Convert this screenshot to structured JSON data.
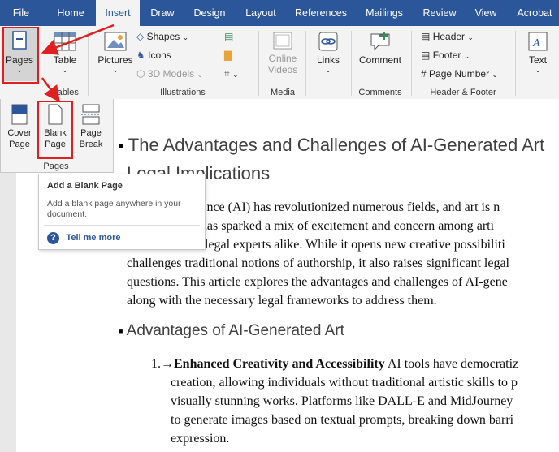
{
  "tabs": [
    "File",
    "Home",
    "Insert",
    "Draw",
    "Design",
    "Layout",
    "References",
    "Mailings",
    "Review",
    "View",
    "Acrobat"
  ],
  "ribbon": {
    "pages": "Pages",
    "table": "Table",
    "tables_group": "Tables",
    "pictures": "Pictures",
    "shapes": "Shapes",
    "icons": "Icons",
    "models": "3D Models",
    "illustrations_group": "Illustrations",
    "online_videos": "Online Videos",
    "media_group": "Media",
    "links": "Links",
    "comment": "Comment",
    "comments_group": "Comments",
    "header": "Header",
    "footer": "Footer",
    "page_number": "Page Number",
    "hf_group": "Header & Footer",
    "text": "Text"
  },
  "pages_panel": {
    "cover": "Cover Page",
    "blank": "Blank Page",
    "break": "Page Break",
    "group": "Pages"
  },
  "tooltip": {
    "title": "Add a Blank Page",
    "desc": "Add a blank page anywhere in your document.",
    "help": "Tell me more"
  },
  "document": {
    "title_line1": "The Advantages and Challenges of AI-Generated Art",
    "title_line2": "Legal Implications",
    "para_lines": [
      "lligence (AI) has revolutionized numerous fields, and art is n",
      "art has sparked a mix of excitement and concern among arti",
      "nd legal experts alike. While it opens new creative possibiliti",
      "challenges traditional notions of authorship, it also raises significant legal",
      "questions. This article explores the advantages and challenges of AI-gene",
      "along with the necessary legal frameworks to address them."
    ],
    "section_heading": "Advantages of AI-Generated Art",
    "list_number": "1.",
    "list_bold": "Enhanced Creativity and Accessibility",
    "list_first_rest": " AI tools have democratiz",
    "list_lines": [
      "creation, allowing individuals without traditional artistic skills to p",
      "visually stunning works. Platforms like DALL-E and MidJourney",
      "to generate images based on textual prompts, breaking down barri",
      "expression."
    ]
  },
  "colors": {
    "ribbon_blue": "#2b579a",
    "annotation_red": "#e02020",
    "help_blue": "#2b579a"
  }
}
